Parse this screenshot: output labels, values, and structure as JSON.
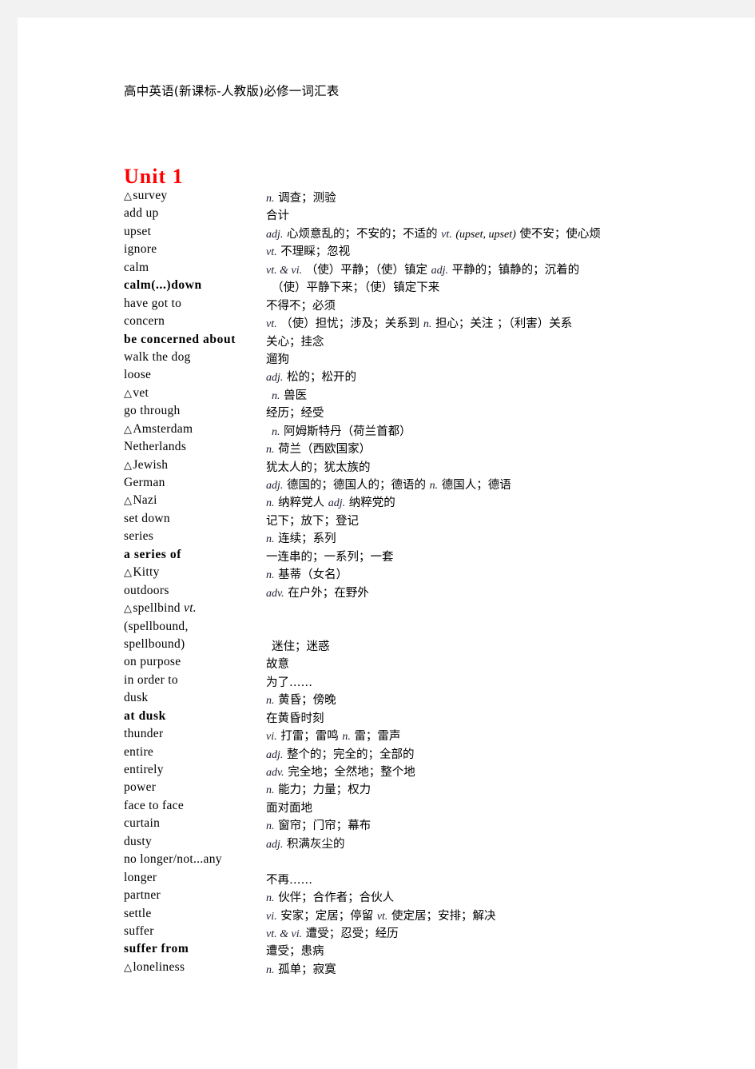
{
  "document": {
    "title": "高中英语(新课标-人教版)必修一词汇表",
    "unit_heading": "Unit 1",
    "heading_color": "#ff0000",
    "page_background": "#ffffff",
    "canvas_background": "#f2f2f2"
  },
  "entries": [
    {
      "word": "survey",
      "marker": "△",
      "bold": false,
      "def_parts": [
        {
          "type": "pos",
          "text": "n."
        },
        {
          "type": "cn",
          "text": "调查；测验"
        }
      ]
    },
    {
      "word": "add up",
      "marker": "",
      "bold": false,
      "def_parts": [
        {
          "type": "cn",
          "text": "合计"
        }
      ]
    },
    {
      "word": "upset",
      "marker": "",
      "bold": false,
      "def_parts": [
        {
          "type": "pos",
          "text": "adj."
        },
        {
          "type": "cn",
          "text": "心烦意乱的；不安的；不适的"
        },
        {
          "type": "pos",
          "text": "vt."
        },
        {
          "type": "en",
          "text": "(upset, upset)"
        },
        {
          "type": "cn",
          "text": "使不安；使心烦"
        }
      ]
    },
    {
      "word": "ignore",
      "marker": "",
      "bold": false,
      "def_parts": [
        {
          "type": "pos",
          "text": "vt."
        },
        {
          "type": "cn",
          "text": "不理睬；忽视"
        }
      ]
    },
    {
      "word": "calm",
      "marker": "",
      "bold": false,
      "def_parts": [
        {
          "type": "pos",
          "text": "vt. & vi."
        },
        {
          "type": "cn",
          "text": "（使）平静；（使）镇定"
        },
        {
          "type": "pos",
          "text": "adj."
        },
        {
          "type": "cn",
          "text": "平静的；镇静的；沉着的"
        }
      ]
    },
    {
      "word": "calm(...)down",
      "marker": "",
      "bold": true,
      "indent": true,
      "def_parts": [
        {
          "type": "cn",
          "text": "（使）平静下来；（使）镇定下来"
        }
      ]
    },
    {
      "word": "have got to",
      "marker": "",
      "bold": false,
      "def_parts": [
        {
          "type": "cn",
          "text": "不得不；必须"
        }
      ]
    },
    {
      "word": "concern",
      "marker": "",
      "bold": false,
      "def_parts": [
        {
          "type": "pos",
          "text": "vt."
        },
        {
          "type": "cn",
          "text": "（使）担忧；涉及；关系到"
        },
        {
          "type": "pos",
          "text": "n."
        },
        {
          "type": "cn",
          "text": "担心；关注 ；（利害）关系"
        }
      ]
    },
    {
      "word": "be concerned about",
      "marker": "",
      "bold": true,
      "def_parts": [
        {
          "type": "cn",
          "text": "关心；挂念"
        }
      ]
    },
    {
      "word": "walk the dog",
      "marker": "",
      "bold": false,
      "def_parts": [
        {
          "type": "cn",
          "text": "遛狗"
        }
      ]
    },
    {
      "word": "loose",
      "marker": "",
      "bold": false,
      "def_parts": [
        {
          "type": "pos",
          "text": "adj."
        },
        {
          "type": "cn",
          "text": "松的；松开的"
        }
      ]
    },
    {
      "word": "vet",
      "marker": "△",
      "bold": false,
      "indent": true,
      "def_parts": [
        {
          "type": "pos",
          "text": "n."
        },
        {
          "type": "cn",
          "text": "兽医"
        }
      ]
    },
    {
      "word": "go through",
      "marker": "",
      "bold": false,
      "def_parts": [
        {
          "type": "cn",
          "text": "经历；经受"
        }
      ]
    },
    {
      "word": "Amsterdam",
      "marker": "△",
      "bold": false,
      "indent": true,
      "def_parts": [
        {
          "type": "pos",
          "text": "n."
        },
        {
          "type": "cn",
          "text": "阿姆斯特丹（荷兰首都）"
        }
      ]
    },
    {
      "word": "Netherlands",
      "marker": "",
      "bold": false,
      "def_parts": [
        {
          "type": "pos",
          "text": "n."
        },
        {
          "type": "cn",
          "text": "荷兰（西欧国家）"
        }
      ]
    },
    {
      "word": "Jewish",
      "marker": "△",
      "bold": false,
      "def_parts": [
        {
          "type": "cn",
          "text": "犹太人的；犹太族的"
        }
      ]
    },
    {
      "word": "German",
      "marker": "",
      "bold": false,
      "def_parts": [
        {
          "type": "pos",
          "text": "adj."
        },
        {
          "type": "cn",
          "text": "德国的；德国人的；德语的"
        },
        {
          "type": "pos",
          "text": "n."
        },
        {
          "type": "cn",
          "text": " 德国人；德语"
        }
      ]
    },
    {
      "word": "Nazi",
      "marker": "△",
      "bold": false,
      "def_parts": [
        {
          "type": "pos",
          "text": "n."
        },
        {
          "type": "cn",
          "text": "纳粹党人"
        },
        {
          "type": "pos",
          "text": "adj."
        },
        {
          "type": "cn",
          "text": "纳粹党的"
        }
      ]
    },
    {
      "word": "set down",
      "marker": "",
      "bold": false,
      "def_parts": [
        {
          "type": "cn",
          "text": "记下；放下；登记"
        }
      ]
    },
    {
      "word": "series",
      "marker": "",
      "bold": false,
      "def_parts": [
        {
          "type": "pos",
          "text": "n."
        },
        {
          "type": "cn",
          "text": "连续；系列"
        }
      ]
    },
    {
      "word": "a series of",
      "marker": "",
      "bold": true,
      "def_parts": [
        {
          "type": "cn",
          "text": "一连串的；一系列；一套"
        }
      ]
    },
    {
      "word": "Kitty",
      "marker": "△",
      "bold": false,
      "def_parts": [
        {
          "type": "pos",
          "text": "n."
        },
        {
          "type": "cn",
          "text": "基蒂（女名）"
        }
      ]
    },
    {
      "word": "outdoors",
      "marker": "",
      "bold": false,
      "def_parts": [
        {
          "type": "pos",
          "text": "adv."
        },
        {
          "type": "cn",
          "text": "在户外；在野外"
        }
      ]
    },
    {
      "word": "spellbind",
      "word_suffix_italic": "vt.",
      "marker": "△ ",
      "bold": false,
      "def_parts": []
    },
    {
      "word": "(spellbound,",
      "marker": "",
      "bold": false,
      "def_parts": []
    },
    {
      "word": "spellbound)",
      "marker": "",
      "bold": false,
      "indent": true,
      "def_parts": [
        {
          "type": "cn",
          "text": "迷住；迷惑"
        }
      ]
    },
    {
      "word": "on purpose",
      "marker": "",
      "bold": false,
      "def_parts": [
        {
          "type": "cn",
          "text": "故意"
        }
      ]
    },
    {
      "word": "in order to",
      "marker": "",
      "bold": false,
      "def_parts": [
        {
          "type": "cn",
          "text": "为了……"
        }
      ]
    },
    {
      "word": "dusk",
      "marker": "",
      "bold": false,
      "def_parts": [
        {
          "type": "pos",
          "text": "n."
        },
        {
          "type": "cn",
          "text": "黄昏；傍晚"
        }
      ]
    },
    {
      "word": "at dusk",
      "marker": "",
      "bold": true,
      "def_parts": [
        {
          "type": "cn",
          "text": "在黄昏时刻"
        }
      ]
    },
    {
      "word": "thunder",
      "marker": "",
      "bold": false,
      "def_parts": [
        {
          "type": "pos",
          "text": "vi."
        },
        {
          "type": "cn",
          "text": "打雷；雷鸣"
        },
        {
          "type": "pos",
          "text": "n."
        },
        {
          "type": "cn",
          "text": " 雷；雷声"
        }
      ]
    },
    {
      "word": "entire",
      "marker": "",
      "bold": false,
      "def_parts": [
        {
          "type": "pos",
          "text": "adj."
        },
        {
          "type": "cn",
          "text": "整个的；完全的；全部的"
        }
      ]
    },
    {
      "word": "entirely",
      "marker": "",
      "bold": false,
      "def_parts": [
        {
          "type": "pos",
          "text": "adv."
        },
        {
          "type": "cn",
          "text": "完全地；全然地；整个地"
        }
      ]
    },
    {
      "word": "power",
      "marker": "",
      "bold": false,
      "def_parts": [
        {
          "type": "pos",
          "text": "n."
        },
        {
          "type": "cn",
          "text": "能力；力量；权力"
        }
      ]
    },
    {
      "word": "face to face",
      "marker": "",
      "bold": false,
      "def_parts": [
        {
          "type": "cn",
          "text": "面对面地"
        }
      ]
    },
    {
      "word": "curtain",
      "marker": "",
      "bold": false,
      "def_parts": [
        {
          "type": "pos",
          "text": "n."
        },
        {
          "type": "cn",
          "text": "窗帘；门帘；幕布"
        }
      ]
    },
    {
      "word": "dusty",
      "marker": "",
      "bold": false,
      "def_parts": [
        {
          "type": "pos",
          "text": "adj."
        },
        {
          "type": "cn",
          "text": "积满灰尘的"
        }
      ]
    },
    {
      "word": "no longer/not...any",
      "marker": "",
      "bold": false,
      "def_parts": []
    },
    {
      "word": "longer",
      "marker": "",
      "bold": false,
      "def_parts": [
        {
          "type": "cn",
          "text": "不再……"
        }
      ]
    },
    {
      "word": "partner",
      "marker": "",
      "bold": false,
      "def_parts": [
        {
          "type": "pos",
          "text": "n."
        },
        {
          "type": "cn",
          "text": "伙伴；合作者；合伙人"
        }
      ]
    },
    {
      "word": "settle",
      "marker": "",
      "bold": false,
      "def_parts": [
        {
          "type": "pos",
          "text": "vi."
        },
        {
          "type": "cn",
          "text": "安家；定居；停留"
        },
        {
          "type": "pos",
          "text": "vt."
        },
        {
          "type": "cn",
          "text": "使定居；安排；解决"
        }
      ]
    },
    {
      "word": "suffer",
      "marker": "",
      "bold": false,
      "def_parts": [
        {
          "type": "pos",
          "text": "vt. & vi."
        },
        {
          "type": "cn",
          "text": "遭受；忍受；经历"
        }
      ]
    },
    {
      "word": "suffer from",
      "marker": "",
      "bold": true,
      "def_parts": [
        {
          "type": "cn",
          "text": "遭受；患病"
        }
      ]
    },
    {
      "word": "loneliness",
      "marker": "△",
      "bold": false,
      "def_parts": [
        {
          "type": "pos",
          "text": "n."
        },
        {
          "type": "cn",
          "text": "孤单；寂寞"
        }
      ]
    }
  ]
}
